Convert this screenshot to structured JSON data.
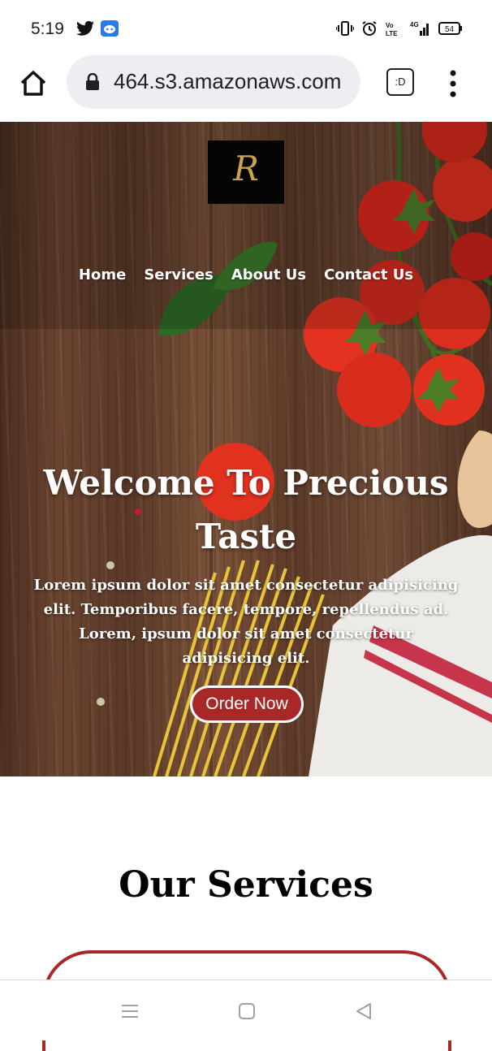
{
  "status_bar": {
    "time": "5:19",
    "battery": "54",
    "left_icons": [
      "twitter-icon",
      "discord-icon"
    ],
    "right_icons": [
      "vibrate-icon",
      "alarm-icon",
      "volte-icon",
      "signal-4g-icon",
      "battery-icon"
    ]
  },
  "browser": {
    "url": "464.s3.amazonaws.com",
    "tab_label": ":D",
    "icons": [
      "home-icon",
      "lock-icon",
      "tab-switcher-icon",
      "more-menu-icon"
    ]
  },
  "site": {
    "logo_letter": "R",
    "nav": [
      "Home",
      "Services",
      "About Us",
      "Contact Us"
    ],
    "hero": {
      "title": "Welcome To Precious Taste",
      "text": "Lorem ipsum dolor sit amet consectetur adipisicing elit. Temporibus facere, tempore, repellendus ad. Lorem, ipsum dolor sit amet consectetur adipisicing elit.",
      "button": "Order Now"
    },
    "services_title": "Our Services"
  },
  "system_nav": {
    "icons": [
      "recent-apps-icon",
      "home-square-icon",
      "back-triangle-icon"
    ]
  },
  "colors": {
    "accent": "#a82828",
    "logo_gold": "#c9a44a"
  }
}
